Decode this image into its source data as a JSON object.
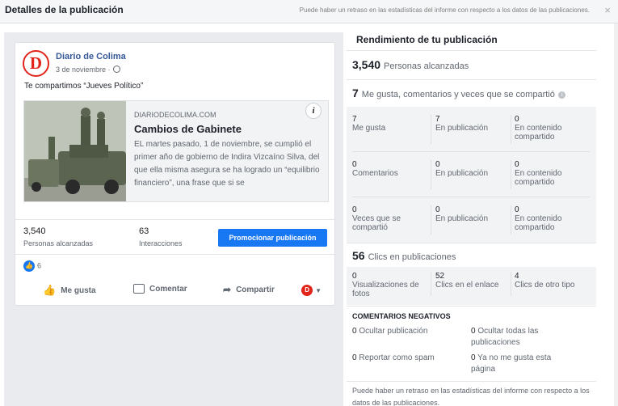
{
  "header": {
    "title": "Detalles de la publicación",
    "notice": "Puede haber un retraso en las estadísticas del informe con respecto a los datos de las publicaciones.",
    "close": "×"
  },
  "post": {
    "page_name": "Diario de Colima",
    "avatar_letter": "D",
    "date": "3 de noviembre ·",
    "text": "Te compartimos “Jueves Político”",
    "link": {
      "domain": "DIARIODECOLIMA.COM",
      "title": "Cambios de Gabinete",
      "description": "EL martes pasado, 1 de noviembre, se cumplió el primer año de gobierno de Indira Vizcaíno Silva, del que ella misma asegura se ha logrado un “equilibrio financiero”, una frase que si se"
    },
    "info_label": "i",
    "stats": {
      "reach_value": "3,540",
      "reach_label": "Personas alcanzadas",
      "interactions_value": "63",
      "interactions_label": "Interacciones",
      "promote_label": "Promocionar publicación"
    },
    "reaction_count": "6",
    "actions": {
      "like": "Me gusta",
      "comment": "Comentar",
      "share": "Compartir"
    }
  },
  "performance": {
    "title": "Rendimiento de tu publicación",
    "reach": {
      "value": "3,540",
      "label": "Personas alcanzadas"
    },
    "engagement": {
      "value": "7",
      "label": "Me gusta, comentarios y veces que se compartió"
    },
    "rows": [
      {
        "cells": [
          {
            "n": "7",
            "l": "Me gusta"
          },
          {
            "n": "7",
            "l": "En publicación"
          },
          {
            "n": "0",
            "l": "En contenido compartido"
          }
        ]
      },
      {
        "cells": [
          {
            "n": "0",
            "l": "Comentarios"
          },
          {
            "n": "0",
            "l": "En publicación"
          },
          {
            "n": "0",
            "l": "En contenido compartido"
          }
        ]
      },
      {
        "cells": [
          {
            "n": "0",
            "l": "Veces que se compartió"
          },
          {
            "n": "0",
            "l": "En publicación"
          },
          {
            "n": "0",
            "l": "En contenido compartido"
          }
        ]
      }
    ],
    "clicks": {
      "value": "56",
      "label": "Clics en publicaciones"
    },
    "click_cells": [
      {
        "n": "0",
        "l": "Visualizaciones de fotos"
      },
      {
        "n": "52",
        "l": "Clics en el enlace"
      },
      {
        "n": "4",
        "l": "Clics de otro tipo"
      }
    ],
    "negative": {
      "title": "COMENTARIOS NEGATIVOS",
      "items": [
        {
          "n": "0",
          "l": "Ocultar publicación"
        },
        {
          "n": "0",
          "l": "Ocultar todas las publicaciones"
        },
        {
          "n": "0",
          "l": "Reportar como spam"
        },
        {
          "n": "0",
          "l": "Ya no me gusta esta página"
        }
      ]
    },
    "footer": "Puede haber un retraso en las estadísticas del informe con respecto a los datos de las publicaciones."
  },
  "colors": {
    "accent": "#1877f2",
    "brand": "#e1251b"
  }
}
